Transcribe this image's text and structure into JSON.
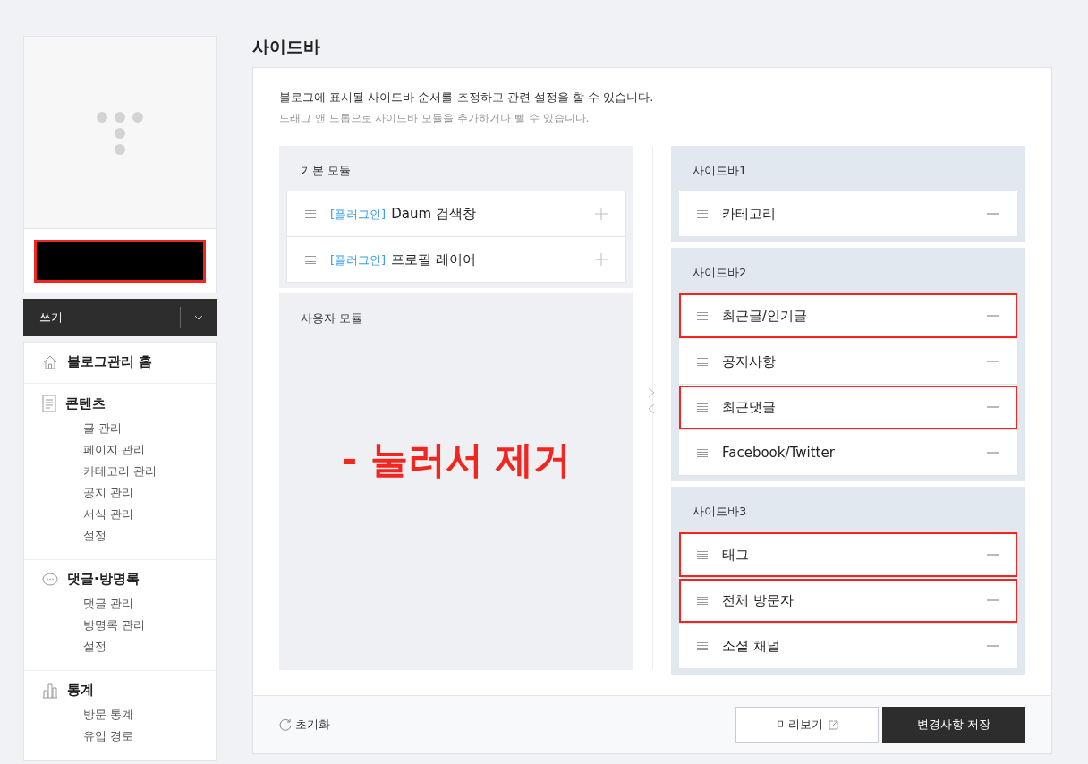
{
  "sidebar": {
    "profile": {
      "name_redacted": true
    },
    "write_button": {
      "label": "쓰기"
    },
    "menu": [
      {
        "title": "블로그관리 홈"
      },
      {
        "title": "콘텐츠",
        "items": [
          "글 관리",
          "페이지 관리",
          "카테고리 관리",
          "공지 관리",
          "서식 관리",
          "설정"
        ]
      },
      {
        "title": "댓글·방명록",
        "items": [
          "댓글 관리",
          "방명록 관리",
          "설정"
        ]
      },
      {
        "title": "통계",
        "items": [
          "방문 통계",
          "유입 경로"
        ]
      }
    ]
  },
  "page": {
    "title": "사이드바",
    "description": "블로그에 표시될 사이드바 순서를 조정하고 관련 설정을 할 수 있습니다.",
    "hint": "드래그 앤 드롭으로 사이드바 모듈을 추가하거나 뺄 수 있습니다."
  },
  "available": [
    {
      "title": "기본 모듈",
      "modules": [
        {
          "tag": "[플러그인]",
          "name": "Daum 검색창"
        },
        {
          "tag": "[플러그인]",
          "name": "프로필 레이어"
        }
      ]
    },
    {
      "title": "사용자 모듈",
      "annotation": "- 눌러서 제거"
    }
  ],
  "sidebars": [
    {
      "title": "사이드바1",
      "modules": [
        {
          "name": "카테고리",
          "highlighted": false
        }
      ]
    },
    {
      "title": "사이드바2",
      "modules": [
        {
          "name": "최근글/인기글",
          "highlighted": true
        },
        {
          "name": "공지사항",
          "highlighted": false
        },
        {
          "name": "최근댓글",
          "highlighted": true
        },
        {
          "name": "Facebook/Twitter",
          "highlighted": false
        }
      ]
    },
    {
      "title": "사이드바3",
      "modules": [
        {
          "name": "태그",
          "highlighted": true
        },
        {
          "name": "전체 방문자",
          "highlighted": true
        },
        {
          "name": "소셜 채널",
          "highlighted": false
        }
      ]
    }
  ],
  "footer": {
    "reset": "초기화",
    "preview": "미리보기",
    "save": "변경사항 저장"
  }
}
